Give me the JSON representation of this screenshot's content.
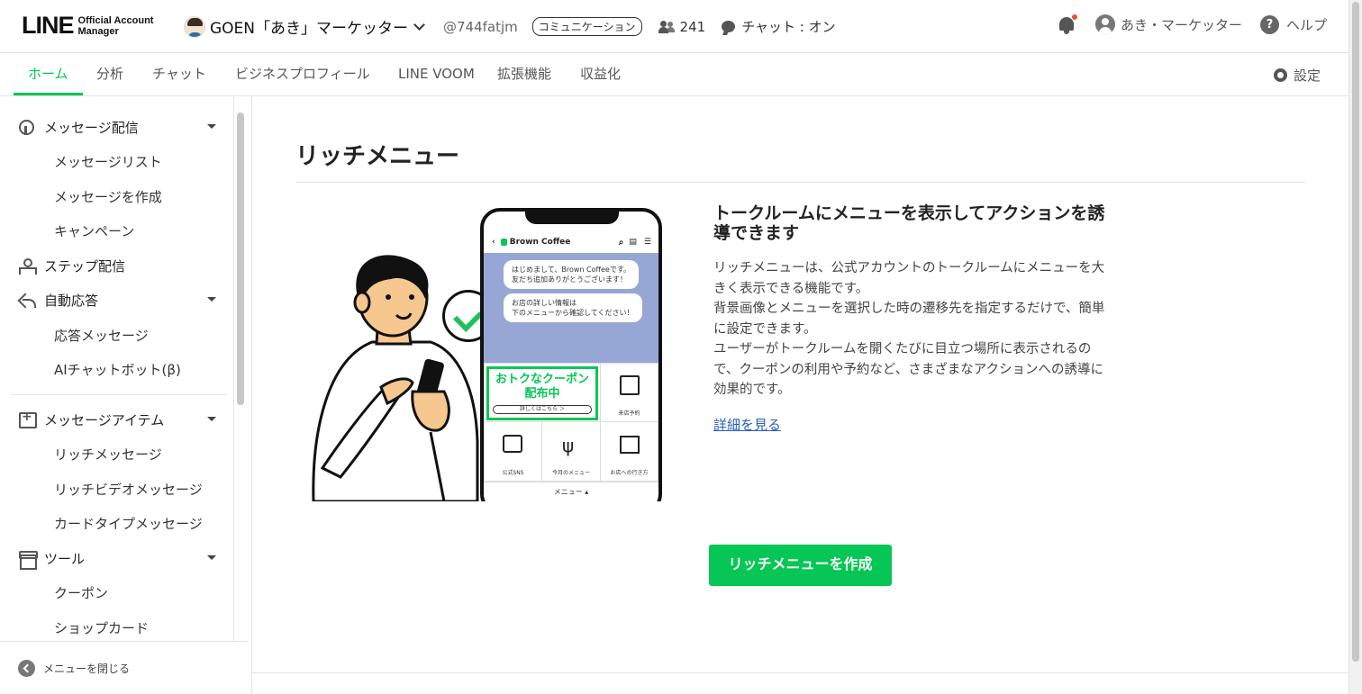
{
  "header": {
    "logo_main": "LINE",
    "logo_sub_1": "Official Account",
    "logo_sub_2": "Manager",
    "account_name": "GOEN「あき」マーケッター",
    "account_id": "@744fatjm",
    "account_badge": "コミュニケーション",
    "friends_count": "241",
    "chat_status": "チャット : オン",
    "user_name": "あき・マーケッター",
    "help_label": "ヘルプ",
    "help_glyph": "?"
  },
  "tabs": [
    {
      "label": "ホーム",
      "active": true
    },
    {
      "label": "分析"
    },
    {
      "label": "チャット"
    },
    {
      "label": "ビジネスプロフィール"
    },
    {
      "label": "LINE VOOM"
    },
    {
      "label": "拡張機能"
    },
    {
      "label": "収益化"
    }
  ],
  "settings_label": "設定",
  "sidebar": {
    "groups": [
      {
        "label": "メッセージ配信",
        "icon": "broadcast-icon",
        "items": [
          "メッセージリスト",
          "メッセージを作成",
          "キャンペーン"
        ]
      },
      {
        "label": "ステップ配信",
        "icon": "step-icon",
        "items": []
      },
      {
        "label": "自動応答",
        "icon": "auto-reply-icon",
        "items": [
          "応答メッセージ",
          "AIチャットボット(β)"
        ]
      },
      {
        "label": "メッセージアイテム",
        "icon": "message-item-icon",
        "items": [
          "リッチメッセージ",
          "リッチビデオメッセージ",
          "カードタイプメッセージ"
        ]
      },
      {
        "label": "ツール",
        "icon": "tool-icon",
        "items": [
          "クーポン",
          "ショップカード"
        ]
      }
    ],
    "close_label": "メニューを閉じる"
  },
  "main": {
    "page_title": "リッチメニュー",
    "headline": "トークルームにメニューを表示してアクションを誘導できます",
    "description": "リッチメニューは、公式アカウントのトークルームにメニューを大きく表示できる機能です。\n背景画像とメニューを選択した時の遷移先を指定するだけで、簡単に設定できます。\nユーザーがトークルームを開くたびに目立つ場所に表示されるので、クーポンの利用や予約など、さまざまなアクションへの誘導に効果的です。",
    "more_link": "詳細を見る",
    "cta_label": "リッチメニューを作成"
  },
  "illustration": {
    "chat_name": "Brown Coffee",
    "bubble_1_line_1": "はじめまして、Brown Coffeeです。",
    "bubble_1_line_2": "友だち追加ありがとうございます！",
    "bubble_2_line_1": "お店の詳しい情報は",
    "bubble_2_line_2": "下のメニューから確認してください！",
    "coupon_line_1": "おトクなクーポン",
    "coupon_line_2": "配布中",
    "coupon_sub": "詳しくはこちら ＞",
    "cell_reserve": "来店予約",
    "cell_sns": "公式SNS",
    "cell_menu": "今月のメニュー",
    "cell_access": "お店への行き方",
    "footer_menu": "メニュー ▴"
  },
  "colors": {
    "accent": "#06c755",
    "link": "#2a5fc1",
    "notification_dot": "#e5532f",
    "chat_bg": "#97a7d5"
  }
}
